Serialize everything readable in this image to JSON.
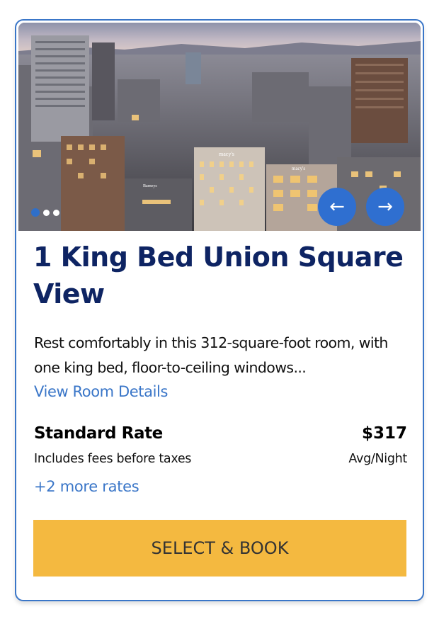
{
  "room": {
    "title": "1 King Bed Union Square View",
    "description": "Rest comfortably in this 312-square-foot room, with one king bed, floor-to-ceiling windows...",
    "details_link": "View Room Details"
  },
  "gallery": {
    "total_slides": 3,
    "active_slide": 1,
    "prev_icon": "arrow-left-icon",
    "next_icon": "arrow-right-icon",
    "prev_glyph": "←",
    "next_glyph": "→",
    "signs": [
      "macy's",
      "macy's",
      "Barneys"
    ]
  },
  "rate": {
    "name": "Standard Rate",
    "price": "$317",
    "note": "Includes fees before taxes",
    "unit": "Avg/Night",
    "more_link": "+2 more rates"
  },
  "cta": {
    "label": "SELECT & BOOK"
  },
  "colors": {
    "card_border": "#3a76c8",
    "title": "#0e2463",
    "link": "#3a76c8",
    "nav_button": "#2f6fd0",
    "cta_background": "#f4b940"
  }
}
